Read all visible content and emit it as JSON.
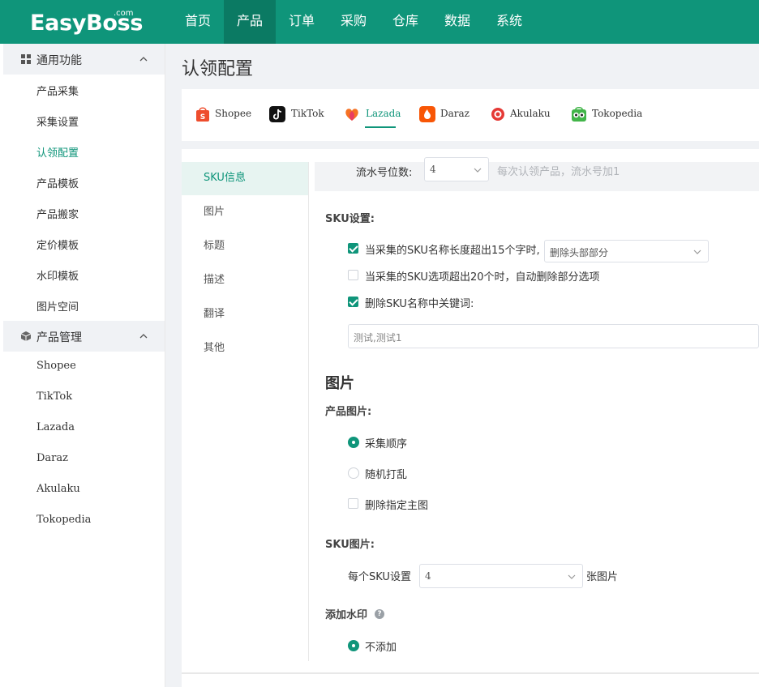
{
  "header": {
    "logo": "EasyBoss",
    "logo_suffix": ".com",
    "nav": [
      "首页",
      "产品",
      "订单",
      "采购",
      "仓库",
      "数据",
      "系统"
    ],
    "active_nav": "产品"
  },
  "sidebar": {
    "group1": {
      "label": "通用功能",
      "icon": "grid-icon"
    },
    "group1_items": [
      "产品采集",
      "采集设置",
      "认领配置",
      "产品模板",
      "产品搬家",
      "定价模板",
      "水印模板",
      "图片空间"
    ],
    "active_item": "认领配置",
    "group2": {
      "label": "产品管理",
      "icon": "cube-icon"
    },
    "group2_items": [
      "Shopee",
      "TikTok",
      "Lazada",
      "Daraz",
      "Akulaku",
      "Tokopedia"
    ]
  },
  "page": {
    "title": "认领配置",
    "platforms": [
      {
        "label": "Shopee",
        "color": "#ee4d2d",
        "icon": "shopee-bag-icon"
      },
      {
        "label": "TikTok",
        "color": "#111111",
        "icon": "tiktok-note-icon"
      },
      {
        "label": "Lazada",
        "color": "#f57224",
        "icon": "lazada-heart-icon"
      },
      {
        "label": "Daraz",
        "color": "#f85606",
        "icon": "daraz-icon"
      },
      {
        "label": "Akulaku",
        "color": "#e53935",
        "icon": "akulaku-ring-icon"
      },
      {
        "label": "Tokopedia",
        "color": "#42b549",
        "icon": "tokopedia-owl-icon"
      }
    ],
    "active_platform": "Lazada"
  },
  "left_menu": {
    "items": [
      "SKU信息",
      "图片",
      "标题",
      "描述",
      "翻译",
      "其他"
    ],
    "active": "SKU信息"
  },
  "form": {
    "serial": {
      "label": "流水号位数:",
      "value": "4",
      "hint": "每次认领产品，流水号加1"
    },
    "sku_settings": {
      "label": "SKU设置:",
      "option1": {
        "text": "当采集的SKU名称长度超出15个字时,",
        "checked": true,
        "select_value": "删除头部部分"
      },
      "option2": {
        "text": "当采集的SKU选项超出20个时，自动删除部分选项",
        "checked": false
      },
      "option3": {
        "text": "删除SKU名称中关键词:",
        "checked": true
      },
      "keywords_value": "测试,测试1"
    },
    "images": {
      "title": "图片",
      "product_images_label": "产品图片:",
      "options": [
        {
          "text": "采集顺序",
          "type": "radio",
          "checked": true
        },
        {
          "text": "随机打乱",
          "type": "radio",
          "checked": false
        },
        {
          "text": "删除指定主图",
          "type": "checkbox",
          "checked": false
        }
      ],
      "sku_images_label": "SKU图片:",
      "per_sku_prefix": "每个SKU设置",
      "per_sku_value": "4",
      "per_sku_suffix": "张图片",
      "watermark_label": "添加水印",
      "watermark_help": "?",
      "watermark_option": {
        "text": "不添加",
        "checked": true
      }
    }
  }
}
